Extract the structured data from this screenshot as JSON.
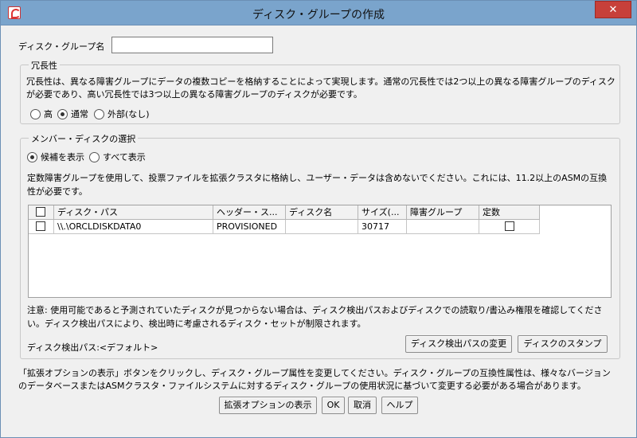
{
  "window": {
    "title": "ディスク・グループの作成",
    "close_label": "✕"
  },
  "disk_group_name": {
    "label": "ディスク・グループ名",
    "value": ""
  },
  "redundancy": {
    "title": "冗長性",
    "description_line1": "冗長性は、異なる障害グループにデータの複数コピーを格納することによって実現します。通常の冗長性では2つ以上の異なる障害グループのディスク",
    "description_line2": "が必要であり、高い冗長性では3つ以上の異なる障害グループのディスクが必要です。",
    "options": [
      {
        "label": "高",
        "selected": false
      },
      {
        "label": "通常",
        "selected": true
      },
      {
        "label": "外部(なし)",
        "selected": false
      }
    ]
  },
  "member_disks": {
    "title": "メンバー・ディスクの選択",
    "filter_options": [
      {
        "label": "候補を表示",
        "selected": true
      },
      {
        "label": "すべて表示",
        "selected": false
      }
    ],
    "info_line1": "定数障害グループを使用して、投票ファイルを拡張クラスタに格納し、ユーザー・データは含めないでください。これには、11.2以上のASMの互換",
    "info_line2": "性が必要です。",
    "table": {
      "columns": [
        "ディスク・パス",
        "ヘッダー・ス...",
        "ディスク名",
        "サイズ(...",
        "障害グループ",
        "定数"
      ],
      "rows": [
        {
          "disk_path": "\\\\.\\ORCLDISKDATA0",
          "header_status": "PROVISIONED",
          "disk_name": "",
          "size": "30717",
          "failure_group": "",
          "quorum": false
        }
      ]
    },
    "note_line1": "注意: 使用可能であると予測されていたディスクが見つからない場合は、ディスク検出パスおよびディスクでの読取り/書込み権限を確認してくださ",
    "note_line2": "い。ディスク検出パスにより、検出時に考慮されるディスク・セットが制限されます。",
    "discovery_path_label": "ディスク検出パス:<デフォルト>",
    "change_path_button": "ディスク検出パスの変更",
    "stamp_disk_button": "ディスクのスタンプ"
  },
  "footer": {
    "info_line1": "「拡張オプションの表示」ボタンをクリックし、ディスク・グループ属性を変更してください。ディスク・グループの互換性属性は、様々なバージョン",
    "info_line2": "のデータベースまたはASMクラスタ・ファイルシステムに対するディスク・グループの使用状況に基づいて変更する必要がある場合があります。",
    "buttons": {
      "advanced": "拡張オプションの表示",
      "ok": "OK",
      "cancel": "取消",
      "help": "ヘルプ"
    }
  }
}
